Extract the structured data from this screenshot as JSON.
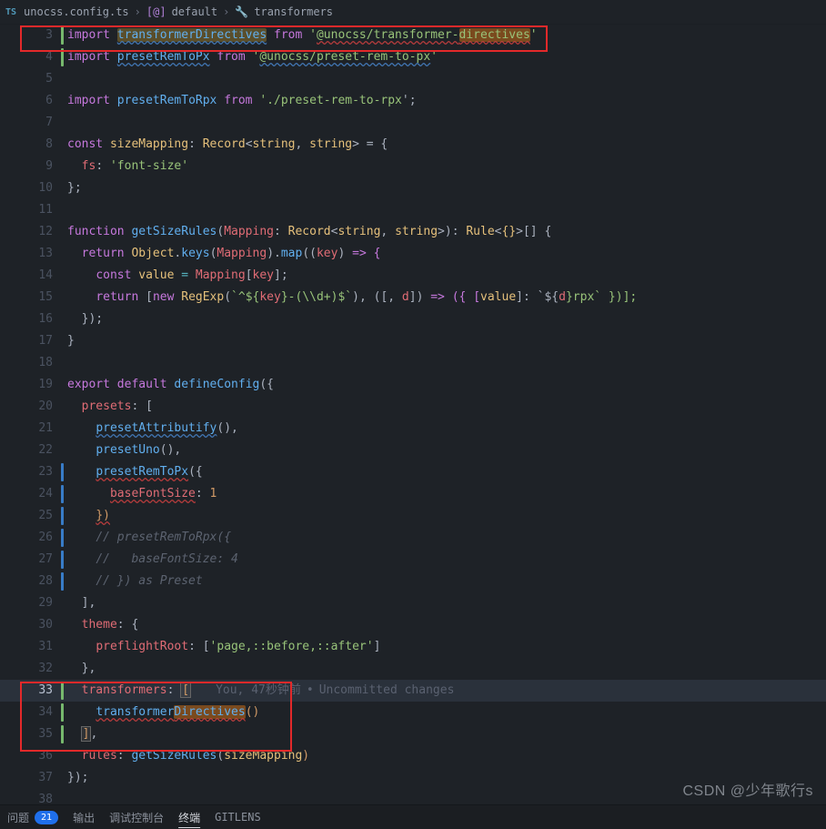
{
  "breadcrumbs": {
    "file_icon": "TS",
    "file": "unocss.config.ts",
    "sym1_icon": "[@]",
    "sym1": "default",
    "sym2_icon": "🔧",
    "sym2": "transformers",
    "sep": "›"
  },
  "lines": {
    "l3": {
      "no": "3",
      "k_import": "import",
      "name": "transformerDirectives",
      "k_from": "from",
      "q": "'",
      "pkg": "@unocss/transformer-",
      "pkg_hi": "directives",
      "end": "'"
    },
    "l4": {
      "no": "4",
      "k_import": "import",
      "name": "presetRemToPx",
      "k_from": "from",
      "q": "'",
      "pkg": "@unocss/preset-rem-to-px",
      "end": "'"
    },
    "l5": {
      "no": "5"
    },
    "l6": {
      "no": "6",
      "k_import": "import",
      "name": "presetRemToRpx",
      "k_from": "from",
      "q": "'",
      "pkg": "./preset-rem-to-rpx",
      "end": "';"
    },
    "l7": {
      "no": "7"
    },
    "l8": {
      "no": "8",
      "k_const": "const",
      "name": "sizeMapping",
      "ty": "Record",
      "tys": "string",
      "eq": "= {"
    },
    "l9": {
      "no": "9",
      "prop": "fs",
      "val": "'font-size'"
    },
    "l10": {
      "no": "10",
      "txt": "};"
    },
    "l11": {
      "no": "11"
    },
    "l12": {
      "no": "12",
      "k_fn": "function",
      "fn": "getSizeRules",
      "p1": "Mapping",
      "ty": "Record",
      "tys": "string",
      "ret": "Rule",
      "retg": "{}",
      "br": "[] {"
    },
    "l13": {
      "no": "13",
      "k_ret": "return",
      "obj": "Object",
      "keys": "keys",
      "arg": "Mapping",
      "map": "map",
      "p": "key",
      "arr": "=> {"
    },
    "l14": {
      "no": "14",
      "k_const": "const",
      "name": "value",
      "eq": "=",
      "m": "Mapping",
      "k": "key",
      "end": "];"
    },
    "l15": {
      "no": "15",
      "k_ret": "return",
      "k_new": "new",
      "re": "RegExp",
      "tpl1": "`^${",
      "key": "key",
      "tpl2": "}-(\\\\d+)$`",
      "p_arr": "[, ",
      "d": "d",
      "p_arr2": "]",
      "arr": "=> ({ [",
      "val": "value",
      "mid": "]: `${",
      "dd": "d",
      "tail": "}rpx` })];"
    },
    "l16": {
      "no": "16",
      "txt": "});"
    },
    "l17": {
      "no": "17",
      "txt": "}"
    },
    "l18": {
      "no": "18"
    },
    "l19": {
      "no": "19",
      "k_exp": "export",
      "k_def": "default",
      "fn": "defineConfig",
      "end": "({"
    },
    "l20": {
      "no": "20",
      "prop": "presets",
      "end": ": ["
    },
    "l21": {
      "no": "21",
      "fn": "presetAttributify",
      "end": "(),"
    },
    "l22": {
      "no": "22",
      "fn": "presetUno",
      "end": "(),"
    },
    "l23": {
      "no": "23",
      "fn": "presetRemToPx",
      "end": "({"
    },
    "l24": {
      "no": "24",
      "prop": "baseFontSize",
      "val": "1"
    },
    "l25": {
      "no": "25",
      "txt": "})"
    },
    "l26": {
      "no": "26",
      "cm": "// presetRemToRpx({"
    },
    "l27": {
      "no": "27",
      "cm": "//   baseFontSize: 4"
    },
    "l28": {
      "no": "28",
      "cm": "// }) as Preset"
    },
    "l29": {
      "no": "29",
      "txt": "],"
    },
    "l30": {
      "no": "30",
      "prop": "theme",
      "end": ": {"
    },
    "l31": {
      "no": "31",
      "prop": "preflightRoot",
      "val": "'page,::before,::after'"
    },
    "l32": {
      "no": "32",
      "txt": "},"
    },
    "l33": {
      "no": "33",
      "prop": "transformers",
      "end": ": ",
      "br": "[",
      "lens_who": "You, 47秒钟前",
      "lens_dot": "•",
      "lens_msg": "Uncommitted changes"
    },
    "l34": {
      "no": "34",
      "fn": "transformerDirectives",
      "fn_hi": "Directives",
      "end": "()"
    },
    "l35": {
      "no": "35",
      "txt": "],"
    },
    "l36": {
      "no": "36",
      "prop": "rules",
      "fn": "getSizeRules",
      "arg": "sizeMapping",
      "end": ")"
    },
    "l37": {
      "no": "37",
      "txt": "});"
    },
    "l38": {
      "no": "38"
    }
  },
  "panel": {
    "problems": "问题",
    "problems_count": "21",
    "output": "输出",
    "debug": "调试控制台",
    "terminal": "终端",
    "gitlens": "GITLENS"
  },
  "watermark": "CSDN @少年歌行s"
}
